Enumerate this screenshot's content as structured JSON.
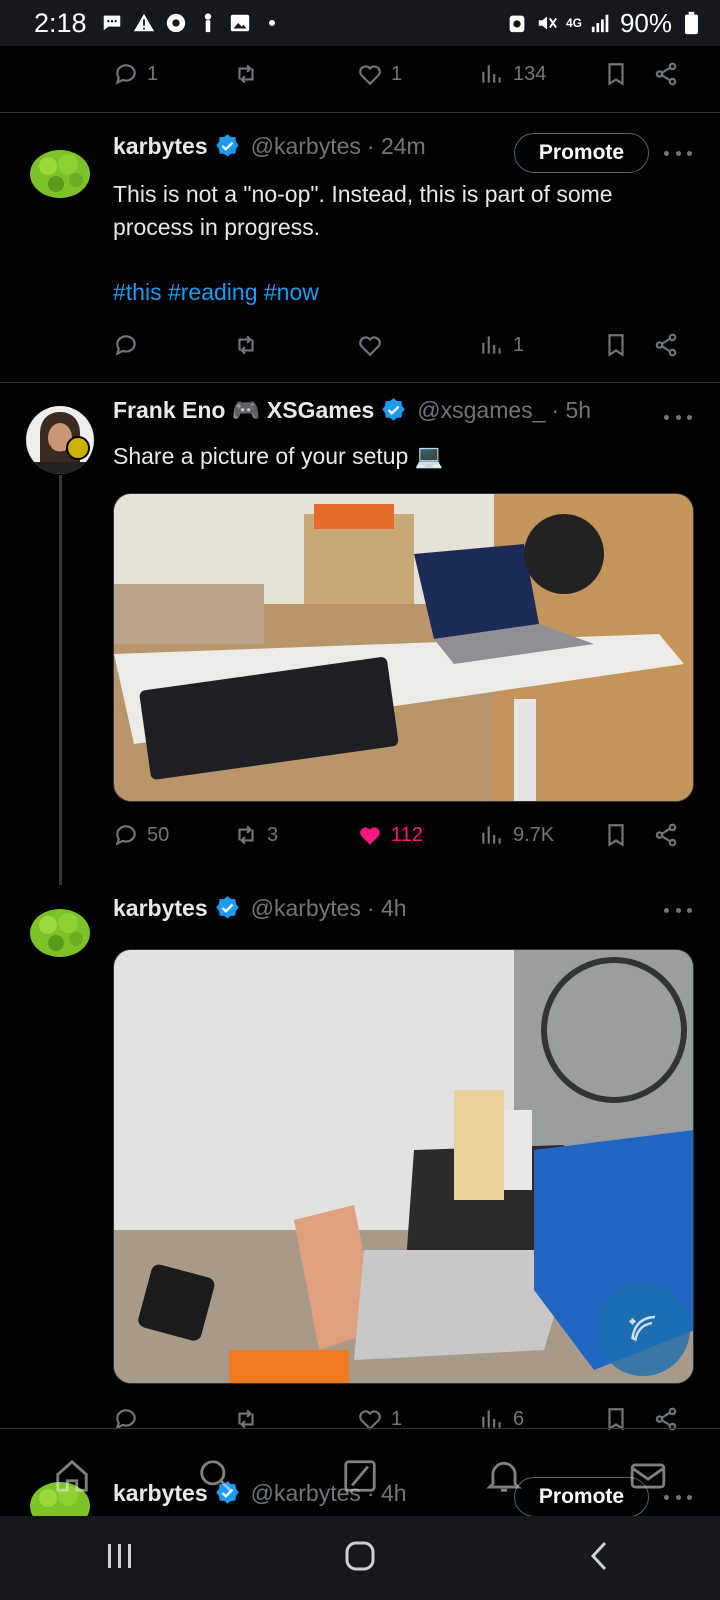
{
  "status_bar": {
    "time": "2:18",
    "battery": "90%",
    "network": "4G"
  },
  "tweets": [
    {
      "id": "top-partial",
      "actions": {
        "replies": "1",
        "retweets": "",
        "likes": "1",
        "views": "134"
      }
    },
    {
      "id": "karbytes-1",
      "name": "karbytes",
      "handle": "@karbytes",
      "time": "· 24m",
      "promote": "Promote",
      "text": "This is not a \"no-op\". Instead, this is part of some process in progress.",
      "hashtags": "#this #reading #now",
      "actions": {
        "replies": "",
        "retweets": "",
        "likes": "",
        "views": "1"
      }
    },
    {
      "id": "frank",
      "name": "Frank Eno 🎮 XSGames",
      "handle": "@xsgames_",
      "time": "· 5h",
      "text": "Share a picture of your setup 💻",
      "actions": {
        "replies": "50",
        "retweets": "3",
        "likes": "112",
        "views": "9.7K"
      }
    },
    {
      "id": "karbytes-2",
      "name": "karbytes",
      "handle": "@karbytes",
      "time": "· 4h",
      "actions": {
        "replies": "",
        "retweets": "",
        "likes": "1",
        "views": "6"
      }
    },
    {
      "id": "karbytes-3",
      "name": "karbytes",
      "handle": "@karbytes",
      "time": "· 4h",
      "promote": "Promote"
    }
  ],
  "colors": {
    "accent": "#1d9bf0",
    "like": "#f91880",
    "muted": "#71767b",
    "background": "#000000"
  }
}
